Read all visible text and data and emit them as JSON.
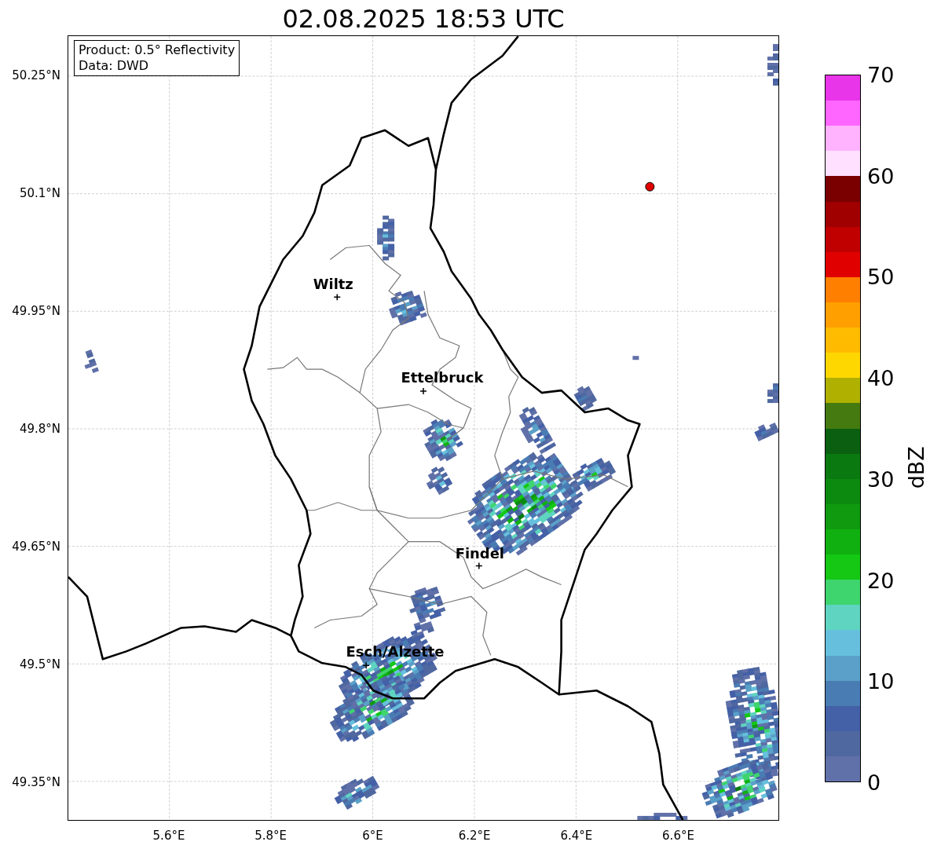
{
  "title": "02.08.2025 18:53 UTC",
  "info_box": [
    "Product: 0.5° Reflectivity",
    "Data: DWD"
  ],
  "map": {
    "y_ticks": [
      "50.25°N",
      "50.1°N",
      "49.95°N",
      "49.8°N",
      "49.65°N",
      "49.5°N",
      "49.35°N"
    ],
    "x_ticks": [
      "5.6°E",
      "5.8°E",
      "6°E",
      "6.2°E",
      "6.4°E",
      "6.6°E"
    ],
    "places": [
      {
        "name": "Wiltz"
      },
      {
        "name": "Ettelbruck"
      },
      {
        "name": "Findel"
      },
      {
        "name": "Esch/Alzette"
      }
    ]
  },
  "colorbar": {
    "label": "dBZ",
    "ticks": [
      "70",
      "60",
      "50",
      "40",
      "30",
      "20",
      "10",
      "0"
    ],
    "segments": [
      {
        "color": "#e935e9"
      },
      {
        "color": "#ff66ff"
      },
      {
        "color": "#ffb3ff"
      },
      {
        "color": "#ffe0ff"
      },
      {
        "color": "#7a0000"
      },
      {
        "color": "#a00000"
      },
      {
        "color": "#c00000"
      },
      {
        "color": "#e00000"
      },
      {
        "color": "#ff7f00"
      },
      {
        "color": "#ff9f00"
      },
      {
        "color": "#ffbb00"
      },
      {
        "color": "#ffd700"
      },
      {
        "color": "#b0b000"
      },
      {
        "color": "#457a10"
      },
      {
        "color": "#0a6010"
      },
      {
        "color": "#0a7a10"
      },
      {
        "color": "#0c8a10"
      },
      {
        "color": "#0f9a10"
      },
      {
        "color": "#10b010"
      },
      {
        "color": "#14c814"
      },
      {
        "color": "#3ed56e"
      },
      {
        "color": "#5fd4c0"
      },
      {
        "color": "#66c0dd"
      },
      {
        "color": "#5aa0c8"
      },
      {
        "color": "#4a7cb4"
      },
      {
        "color": "#4460a6"
      },
      {
        "color": "#5068a0"
      },
      {
        "color": "#6070a8"
      }
    ]
  }
}
